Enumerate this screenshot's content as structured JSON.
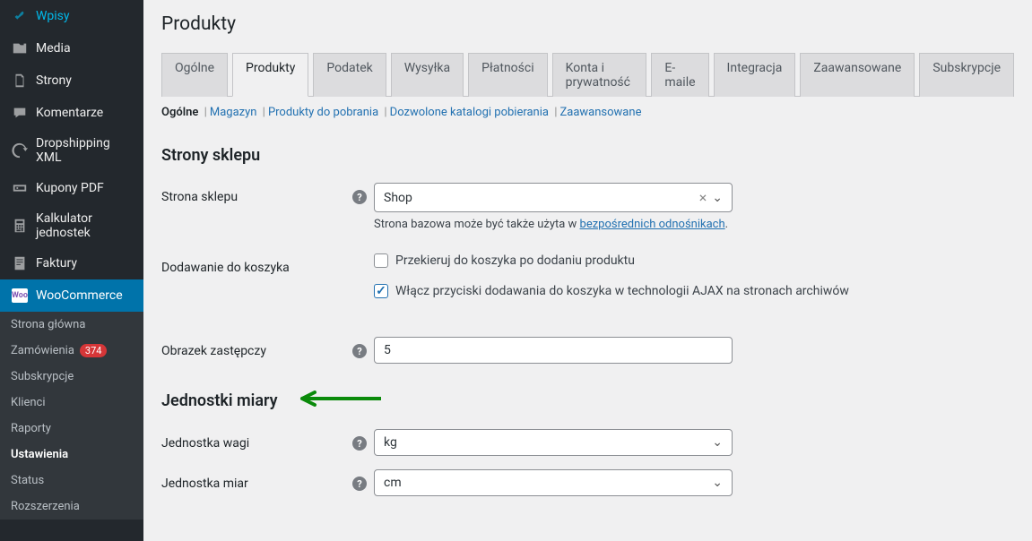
{
  "page": {
    "title": "Produkty"
  },
  "sidebar": {
    "items": [
      {
        "label": "Wpisy",
        "icon": "pin"
      },
      {
        "label": "Media",
        "icon": "media"
      },
      {
        "label": "Strony",
        "icon": "page"
      },
      {
        "label": "Komentarze",
        "icon": "comment"
      },
      {
        "label": "Dropshipping XML",
        "icon": "sync"
      },
      {
        "label": "Kupony PDF",
        "icon": "coupon"
      },
      {
        "label": "Kalkulator jednostek",
        "icon": "calc"
      },
      {
        "label": "Faktury",
        "icon": "invoice"
      },
      {
        "label": "WooCommerce",
        "icon": "woo",
        "active": true
      }
    ],
    "submenu": [
      {
        "label": "Strona główna"
      },
      {
        "label": "Zamówienia",
        "badge": "374"
      },
      {
        "label": "Subskrypcje"
      },
      {
        "label": "Klienci"
      },
      {
        "label": "Raporty"
      },
      {
        "label": "Ustawienia",
        "active": true
      },
      {
        "label": "Status"
      },
      {
        "label": "Rozszerzenia"
      }
    ]
  },
  "tabs": [
    "Ogólne",
    "Produkty",
    "Podatek",
    "Wysyłka",
    "Płatności",
    "Konta i prywatność",
    "E-maile",
    "Integracja",
    "Zaawansowane",
    "Subskrypcje"
  ],
  "active_tab": "Produkty",
  "subtabs": {
    "active": "Ogólne",
    "links": [
      "Magazyn",
      "Produkty do pobrania",
      "Dozwolone katalogi pobierania",
      "Zaawansowane"
    ]
  },
  "section1": {
    "heading": "Strony sklepu",
    "row1_label": "Strona sklepu",
    "row1_value": "Shop",
    "row1_desc_prefix": "Strona bazowa może być także użyta w ",
    "row1_desc_link": "bezpośrednich odnośnikach",
    "row2_label": "Dodawanie do koszyka",
    "row2_cb1": "Przekieruj do koszyka po dodaniu produktu",
    "row2_cb2": "Włącz przyciski dodawania do koszyka w technologii AJAX na stronach archiwów",
    "row3_label": "Obrazek zastępczy",
    "row3_value": "5"
  },
  "section2": {
    "heading": "Jednostki miary",
    "row1_label": "Jednostka wagi",
    "row1_value": "kg",
    "row2_label": "Jednostka miar",
    "row2_value": "cm"
  }
}
